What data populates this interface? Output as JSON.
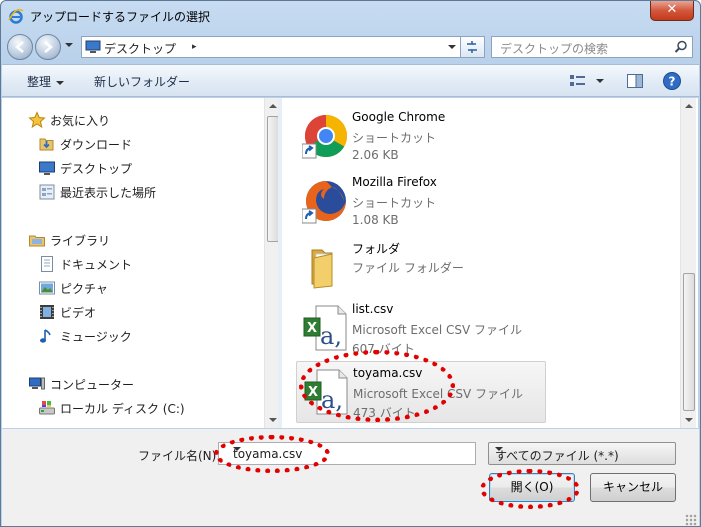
{
  "window": {
    "title": "アップロードするファイルの選択",
    "close_label": "✕"
  },
  "address": {
    "location": "デスクトップ",
    "separator": "▸"
  },
  "search": {
    "placeholder": "デスクトップの検索"
  },
  "toolbar": {
    "organize_label": "整理",
    "new_folder_label": "新しいフォルダー"
  },
  "sidebar": {
    "items": [
      {
        "label": "お気に入り",
        "icon": "star-icon"
      },
      {
        "label": "ダウンロード",
        "icon": "download-folder-icon"
      },
      {
        "label": "デスクトップ",
        "icon": "desktop-icon"
      },
      {
        "label": "最近表示した場所",
        "icon": "recent-places-icon"
      },
      {
        "label": "ライブラリ",
        "icon": "library-icon"
      },
      {
        "label": "ドキュメント",
        "icon": "documents-icon"
      },
      {
        "label": "ピクチャ",
        "icon": "pictures-icon"
      },
      {
        "label": "ビデオ",
        "icon": "videos-icon"
      },
      {
        "label": "ミュージック",
        "icon": "music-icon"
      },
      {
        "label": "コンピューター",
        "icon": "computer-icon"
      },
      {
        "label": "ローカル ディスク (C:)",
        "icon": "local-disk-icon"
      }
    ]
  },
  "files": [
    {
      "name": "Google Chrome",
      "type": "ショートカット",
      "size": "2.06 KB",
      "icon": "chrome-icon"
    },
    {
      "name": "Mozilla Firefox",
      "type": "ショートカット",
      "size": "1.08 KB",
      "icon": "firefox-icon"
    },
    {
      "name": "フォルダ",
      "type": "ファイル フォルダー",
      "size": "",
      "icon": "folder-icon"
    },
    {
      "name": "list.csv",
      "type": "Microsoft Excel CSV ファイル",
      "size": "607 バイト",
      "icon": "excel-csv-icon"
    },
    {
      "name": "toyama.csv",
      "type": "Microsoft Excel CSV ファイル",
      "size": "473 バイト",
      "icon": "excel-csv-icon",
      "selected": true
    }
  ],
  "bottom": {
    "filename_label": "ファイル名(N):",
    "filename_value": "toyama.csv",
    "filter_value": "すべてのファイル (*.*)",
    "open_label": "開く(O)",
    "cancel_label": "キャンセル"
  },
  "colors": {
    "annotation": "#e30000",
    "selection": "#e6e6e6"
  }
}
